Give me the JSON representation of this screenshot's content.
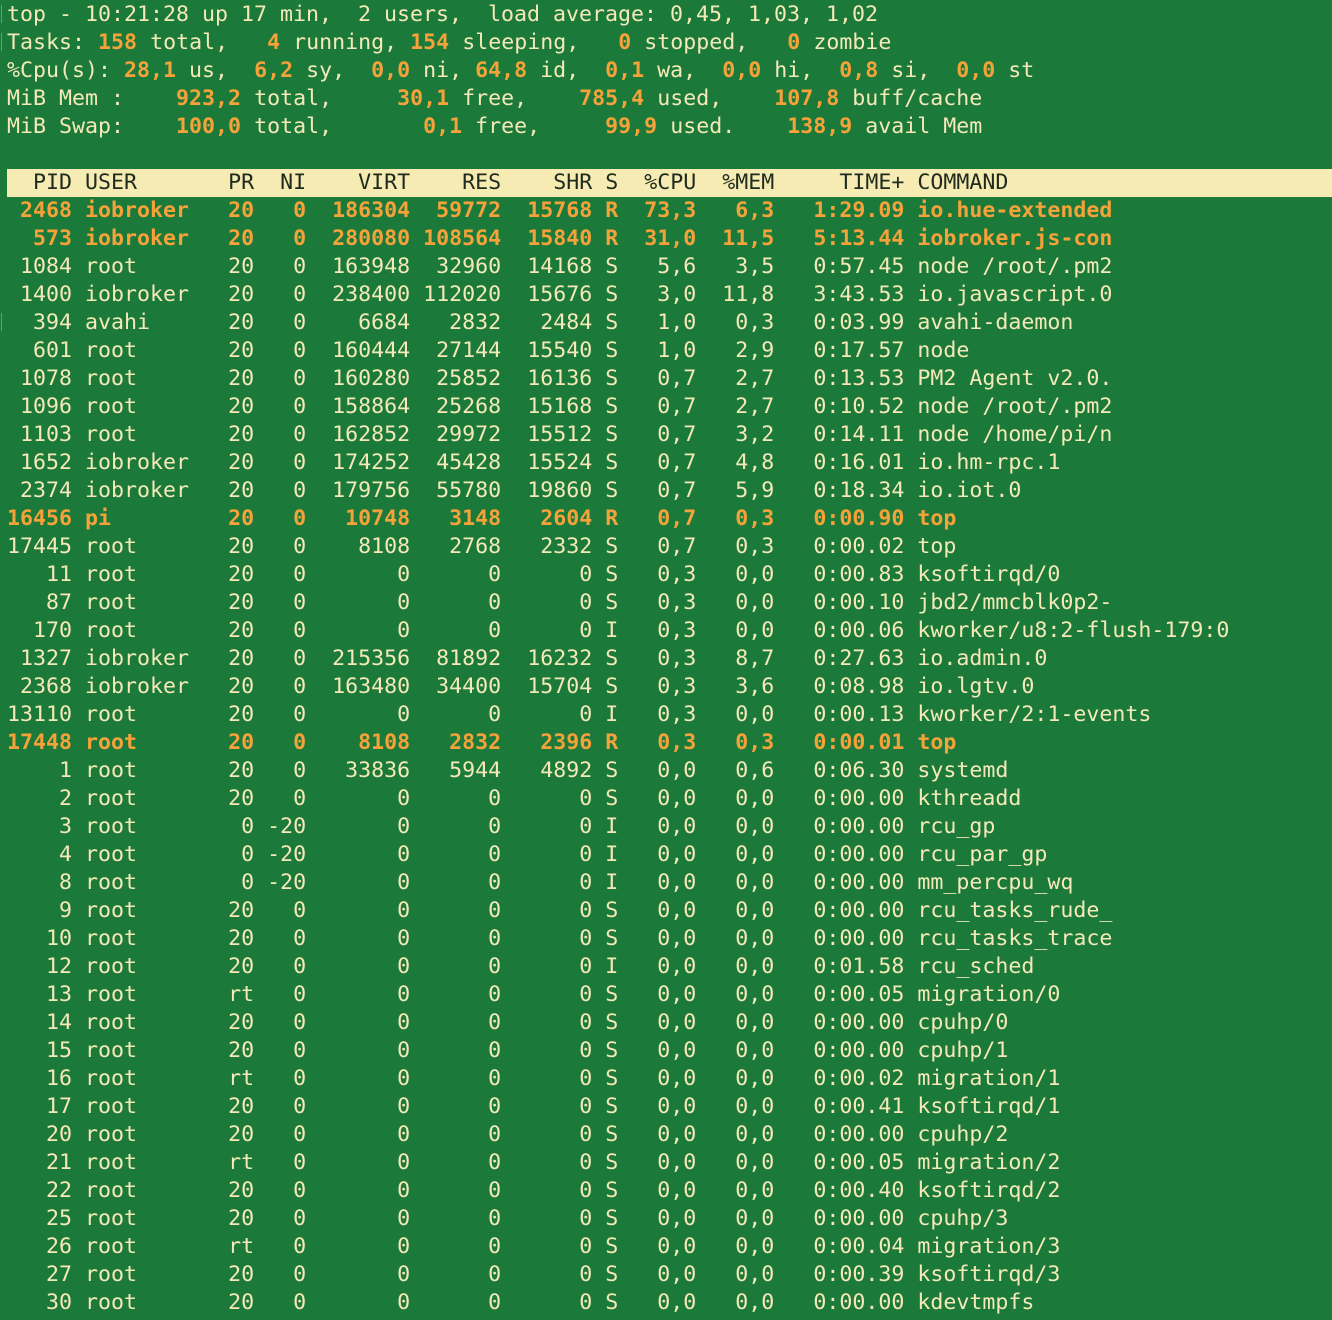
{
  "summary": {
    "uptime_line": "top - 10:21:28 up 17 min,  2 users,  load average: 0,45, 1,03, 1,02",
    "tasks": {
      "label": "Tasks:",
      "total": "158",
      "total_label": "total,",
      "running": "4",
      "running_label": "running,",
      "sleeping": "154",
      "sleeping_label": "sleeping,",
      "stopped": "0",
      "stopped_label": "stopped,",
      "zombie": "0",
      "zombie_label": "zombie"
    },
    "cpu": {
      "label": "%Cpu(s):",
      "us": "28,1",
      "sy": "6,2",
      "ni": "0,0",
      "id": "64,8",
      "wa": "0,1",
      "hi": "0,0",
      "si": "0,8",
      "st": "0,0"
    },
    "mem": {
      "label": "MiB Mem :",
      "total": "923,2",
      "free": "30,1",
      "used": "785,4",
      "buff_cache": "107,8",
      "total_label": "total,",
      "free_label": "free,",
      "used_label": "used,",
      "buff_label": "buff/cache"
    },
    "swap": {
      "label": "MiB Swap:",
      "total": "100,0",
      "free": "0,1",
      "used": "99,9",
      "avail": "138,9",
      "total_label": "total,",
      "free_label": "free,",
      "used_label": "used.",
      "avail_label": "avail Mem"
    }
  },
  "columns": [
    "PID",
    "USER",
    "PR",
    "NI",
    "VIRT",
    "RES",
    "SHR",
    "S",
    "%CPU",
    "%MEM",
    "TIME+",
    "COMMAND"
  ],
  "processes": [
    {
      "pid": "2468",
      "user": "iobroker",
      "pr": "20",
      "ni": "0",
      "virt": "186304",
      "res": "59772",
      "shr": "15768",
      "s": "R",
      "cpu": "73,3",
      "mem": "6,3",
      "time": "1:29.09",
      "cmd": "io.hue-extended",
      "hl": true
    },
    {
      "pid": "573",
      "user": "iobroker",
      "pr": "20",
      "ni": "0",
      "virt": "280080",
      "res": "108564",
      "shr": "15840",
      "s": "R",
      "cpu": "31,0",
      "mem": "11,5",
      "time": "5:13.44",
      "cmd": "iobroker.js-con",
      "hl": true
    },
    {
      "pid": "1084",
      "user": "root",
      "pr": "20",
      "ni": "0",
      "virt": "163948",
      "res": "32960",
      "shr": "14168",
      "s": "S",
      "cpu": "5,6",
      "mem": "3,5",
      "time": "0:57.45",
      "cmd": "node /root/.pm2"
    },
    {
      "pid": "1400",
      "user": "iobroker",
      "pr": "20",
      "ni": "0",
      "virt": "238400",
      "res": "112020",
      "shr": "15676",
      "s": "S",
      "cpu": "3,0",
      "mem": "11,8",
      "time": "3:43.53",
      "cmd": "io.javascript.0"
    },
    {
      "pid": "394",
      "user": "avahi",
      "pr": "20",
      "ni": "0",
      "virt": "6684",
      "res": "2832",
      "shr": "2484",
      "s": "S",
      "cpu": "1,0",
      "mem": "0,3",
      "time": "0:03.99",
      "cmd": "avahi-daemon"
    },
    {
      "pid": "601",
      "user": "root",
      "pr": "20",
      "ni": "0",
      "virt": "160444",
      "res": "27144",
      "shr": "15540",
      "s": "S",
      "cpu": "1,0",
      "mem": "2,9",
      "time": "0:17.57",
      "cmd": "node"
    },
    {
      "pid": "1078",
      "user": "root",
      "pr": "20",
      "ni": "0",
      "virt": "160280",
      "res": "25852",
      "shr": "16136",
      "s": "S",
      "cpu": "0,7",
      "mem": "2,7",
      "time": "0:13.53",
      "cmd": "PM2 Agent v2.0."
    },
    {
      "pid": "1096",
      "user": "root",
      "pr": "20",
      "ni": "0",
      "virt": "158864",
      "res": "25268",
      "shr": "15168",
      "s": "S",
      "cpu": "0,7",
      "mem": "2,7",
      "time": "0:10.52",
      "cmd": "node /root/.pm2"
    },
    {
      "pid": "1103",
      "user": "root",
      "pr": "20",
      "ni": "0",
      "virt": "162852",
      "res": "29972",
      "shr": "15512",
      "s": "S",
      "cpu": "0,7",
      "mem": "3,2",
      "time": "0:14.11",
      "cmd": "node /home/pi/n"
    },
    {
      "pid": "1652",
      "user": "iobroker",
      "pr": "20",
      "ni": "0",
      "virt": "174252",
      "res": "45428",
      "shr": "15524",
      "s": "S",
      "cpu": "0,7",
      "mem": "4,8",
      "time": "0:16.01",
      "cmd": "io.hm-rpc.1"
    },
    {
      "pid": "2374",
      "user": "iobroker",
      "pr": "20",
      "ni": "0",
      "virt": "179756",
      "res": "55780",
      "shr": "19860",
      "s": "S",
      "cpu": "0,7",
      "mem": "5,9",
      "time": "0:18.34",
      "cmd": "io.iot.0"
    },
    {
      "pid": "16456",
      "user": "pi",
      "pr": "20",
      "ni": "0",
      "virt": "10748",
      "res": "3148",
      "shr": "2604",
      "s": "R",
      "cpu": "0,7",
      "mem": "0,3",
      "time": "0:00.90",
      "cmd": "top",
      "hl": true
    },
    {
      "pid": "17445",
      "user": "root",
      "pr": "20",
      "ni": "0",
      "virt": "8108",
      "res": "2768",
      "shr": "2332",
      "s": "S",
      "cpu": "0,7",
      "mem": "0,3",
      "time": "0:00.02",
      "cmd": "top"
    },
    {
      "pid": "11",
      "user": "root",
      "pr": "20",
      "ni": "0",
      "virt": "0",
      "res": "0",
      "shr": "0",
      "s": "S",
      "cpu": "0,3",
      "mem": "0,0",
      "time": "0:00.83",
      "cmd": "ksoftirqd/0"
    },
    {
      "pid": "87",
      "user": "root",
      "pr": "20",
      "ni": "0",
      "virt": "0",
      "res": "0",
      "shr": "0",
      "s": "S",
      "cpu": "0,3",
      "mem": "0,0",
      "time": "0:00.10",
      "cmd": "jbd2/mmcblk0p2-"
    },
    {
      "pid": "170",
      "user": "root",
      "pr": "20",
      "ni": "0",
      "virt": "0",
      "res": "0",
      "shr": "0",
      "s": "I",
      "cpu": "0,3",
      "mem": "0,0",
      "time": "0:00.06",
      "cmd": "kworker/u8:2-flush-179:0"
    },
    {
      "pid": "1327",
      "user": "iobroker",
      "pr": "20",
      "ni": "0",
      "virt": "215356",
      "res": "81892",
      "shr": "16232",
      "s": "S",
      "cpu": "0,3",
      "mem": "8,7",
      "time": "0:27.63",
      "cmd": "io.admin.0"
    },
    {
      "pid": "2368",
      "user": "iobroker",
      "pr": "20",
      "ni": "0",
      "virt": "163480",
      "res": "34400",
      "shr": "15704",
      "s": "S",
      "cpu": "0,3",
      "mem": "3,6",
      "time": "0:08.98",
      "cmd": "io.lgtv.0"
    },
    {
      "pid": "13110",
      "user": "root",
      "pr": "20",
      "ni": "0",
      "virt": "0",
      "res": "0",
      "shr": "0",
      "s": "I",
      "cpu": "0,3",
      "mem": "0,0",
      "time": "0:00.13",
      "cmd": "kworker/2:1-events"
    },
    {
      "pid": "17448",
      "user": "root",
      "pr": "20",
      "ni": "0",
      "virt": "8108",
      "res": "2832",
      "shr": "2396",
      "s": "R",
      "cpu": "0,3",
      "mem": "0,3",
      "time": "0:00.01",
      "cmd": "top",
      "hl": true
    },
    {
      "pid": "1",
      "user": "root",
      "pr": "20",
      "ni": "0",
      "virt": "33836",
      "res": "5944",
      "shr": "4892",
      "s": "S",
      "cpu": "0,0",
      "mem": "0,6",
      "time": "0:06.30",
      "cmd": "systemd"
    },
    {
      "pid": "2",
      "user": "root",
      "pr": "20",
      "ni": "0",
      "virt": "0",
      "res": "0",
      "shr": "0",
      "s": "S",
      "cpu": "0,0",
      "mem": "0,0",
      "time": "0:00.00",
      "cmd": "kthreadd"
    },
    {
      "pid": "3",
      "user": "root",
      "pr": "0",
      "ni": "-20",
      "virt": "0",
      "res": "0",
      "shr": "0",
      "s": "I",
      "cpu": "0,0",
      "mem": "0,0",
      "time": "0:00.00",
      "cmd": "rcu_gp"
    },
    {
      "pid": "4",
      "user": "root",
      "pr": "0",
      "ni": "-20",
      "virt": "0",
      "res": "0",
      "shr": "0",
      "s": "I",
      "cpu": "0,0",
      "mem": "0,0",
      "time": "0:00.00",
      "cmd": "rcu_par_gp"
    },
    {
      "pid": "8",
      "user": "root",
      "pr": "0",
      "ni": "-20",
      "virt": "0",
      "res": "0",
      "shr": "0",
      "s": "I",
      "cpu": "0,0",
      "mem": "0,0",
      "time": "0:00.00",
      "cmd": "mm_percpu_wq"
    },
    {
      "pid": "9",
      "user": "root",
      "pr": "20",
      "ni": "0",
      "virt": "0",
      "res": "0",
      "shr": "0",
      "s": "S",
      "cpu": "0,0",
      "mem": "0,0",
      "time": "0:00.00",
      "cmd": "rcu_tasks_rude_"
    },
    {
      "pid": "10",
      "user": "root",
      "pr": "20",
      "ni": "0",
      "virt": "0",
      "res": "0",
      "shr": "0",
      "s": "S",
      "cpu": "0,0",
      "mem": "0,0",
      "time": "0:00.00",
      "cmd": "rcu_tasks_trace"
    },
    {
      "pid": "12",
      "user": "root",
      "pr": "20",
      "ni": "0",
      "virt": "0",
      "res": "0",
      "shr": "0",
      "s": "I",
      "cpu": "0,0",
      "mem": "0,0",
      "time": "0:01.58",
      "cmd": "rcu_sched"
    },
    {
      "pid": "13",
      "user": "root",
      "pr": "rt",
      "ni": "0",
      "virt": "0",
      "res": "0",
      "shr": "0",
      "s": "S",
      "cpu": "0,0",
      "mem": "0,0",
      "time": "0:00.05",
      "cmd": "migration/0"
    },
    {
      "pid": "14",
      "user": "root",
      "pr": "20",
      "ni": "0",
      "virt": "0",
      "res": "0",
      "shr": "0",
      "s": "S",
      "cpu": "0,0",
      "mem": "0,0",
      "time": "0:00.00",
      "cmd": "cpuhp/0"
    },
    {
      "pid": "15",
      "user": "root",
      "pr": "20",
      "ni": "0",
      "virt": "0",
      "res": "0",
      "shr": "0",
      "s": "S",
      "cpu": "0,0",
      "mem": "0,0",
      "time": "0:00.00",
      "cmd": "cpuhp/1"
    },
    {
      "pid": "16",
      "user": "root",
      "pr": "rt",
      "ni": "0",
      "virt": "0",
      "res": "0",
      "shr": "0",
      "s": "S",
      "cpu": "0,0",
      "mem": "0,0",
      "time": "0:00.02",
      "cmd": "migration/1"
    },
    {
      "pid": "17",
      "user": "root",
      "pr": "20",
      "ni": "0",
      "virt": "0",
      "res": "0",
      "shr": "0",
      "s": "S",
      "cpu": "0,0",
      "mem": "0,0",
      "time": "0:00.41",
      "cmd": "ksoftirqd/1"
    },
    {
      "pid": "20",
      "user": "root",
      "pr": "20",
      "ni": "0",
      "virt": "0",
      "res": "0",
      "shr": "0",
      "s": "S",
      "cpu": "0,0",
      "mem": "0,0",
      "time": "0:00.00",
      "cmd": "cpuhp/2"
    },
    {
      "pid": "21",
      "user": "root",
      "pr": "rt",
      "ni": "0",
      "virt": "0",
      "res": "0",
      "shr": "0",
      "s": "S",
      "cpu": "0,0",
      "mem": "0,0",
      "time": "0:00.05",
      "cmd": "migration/2"
    },
    {
      "pid": "22",
      "user": "root",
      "pr": "20",
      "ni": "0",
      "virt": "0",
      "res": "0",
      "shr": "0",
      "s": "S",
      "cpu": "0,0",
      "mem": "0,0",
      "time": "0:00.40",
      "cmd": "ksoftirqd/2"
    },
    {
      "pid": "25",
      "user": "root",
      "pr": "20",
      "ni": "0",
      "virt": "0",
      "res": "0",
      "shr": "0",
      "s": "S",
      "cpu": "0,0",
      "mem": "0,0",
      "time": "0:00.00",
      "cmd": "cpuhp/3"
    },
    {
      "pid": "26",
      "user": "root",
      "pr": "rt",
      "ni": "0",
      "virt": "0",
      "res": "0",
      "shr": "0",
      "s": "S",
      "cpu": "0,0",
      "mem": "0,0",
      "time": "0:00.04",
      "cmd": "migration/3"
    },
    {
      "pid": "27",
      "user": "root",
      "pr": "20",
      "ni": "0",
      "virt": "0",
      "res": "0",
      "shr": "0",
      "s": "S",
      "cpu": "0,0",
      "mem": "0,0",
      "time": "0:00.39",
      "cmd": "ksoftirqd/3"
    },
    {
      "pid": "30",
      "user": "root",
      "pr": "20",
      "ni": "0",
      "virt": "0",
      "res": "0",
      "shr": "0",
      "s": "S",
      "cpu": "0,0",
      "mem": "0,0",
      "time": "0:00.00",
      "cmd": "kdevtmpfs"
    }
  ],
  "colors": {
    "background": "#1b7a3a",
    "text": "#f5e9b8",
    "highlight": "#f5a23a",
    "header_bar": "#f6ebb2",
    "header_text": "#1d2a1d"
  }
}
